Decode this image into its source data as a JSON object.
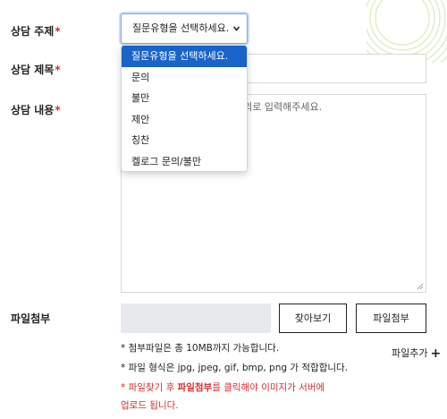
{
  "form": {
    "topic": {
      "label": "상담 주제",
      "required_mark": "*",
      "selected_value": "질문유형을 선택하세요."
    },
    "title": {
      "label": "상담 제목",
      "required_mark": "*",
      "value": ""
    },
    "content": {
      "label": "상담 내용",
      "required_mark": "*",
      "placeholder_visible_part": "내외로 입력해주세요."
    },
    "attachment": {
      "label": "파일첨부"
    }
  },
  "dropdown": {
    "options": [
      {
        "label": "질문유형을 선택하세요.",
        "selected": true
      },
      {
        "label": "문의",
        "selected": false
      },
      {
        "label": "불만",
        "selected": false
      },
      {
        "label": "제안",
        "selected": false
      },
      {
        "label": "칭찬",
        "selected": false
      },
      {
        "label": "켈로그 문의/불만",
        "selected": false
      }
    ]
  },
  "buttons": {
    "browse": "찾아보기",
    "attach": "파일첨부",
    "add_file": "파일추가",
    "add_file_icon": "plus-icon"
  },
  "notes": {
    "line1": "* 첨부파일은 총 10MB까지 가능합니다.",
    "line2": "* 파일 형식은 jpg, jpeg, gif, bmp, png 가 적합합니다.",
    "line3_prefix": "* 파일찾기 후 ",
    "line3_bold": "파일첨부",
    "line3_suffix": "를 클릭해야 이미지가 서버에",
    "line4": "업로드 됩니다."
  },
  "colors": {
    "required": "#d92b2b",
    "selected_option_bg": "#1a64c8",
    "decoration": "#d9ecb4",
    "file_field_bg": "#e7e9ed"
  }
}
